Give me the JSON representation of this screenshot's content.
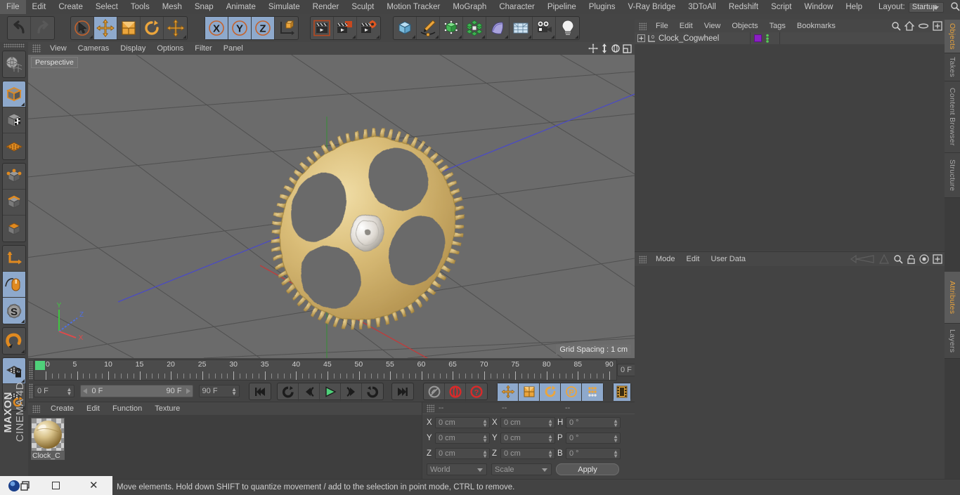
{
  "menubar": {
    "items": [
      "File",
      "Edit",
      "Create",
      "Select",
      "Tools",
      "Mesh",
      "Snap",
      "Animate",
      "Simulate",
      "Render",
      "Sculpt",
      "Motion Tracker",
      "MoGraph",
      "Character",
      "Pipeline",
      "Plugins",
      "V-Ray Bridge",
      "3DToAll",
      "Redshift",
      "Script",
      "Window",
      "Help"
    ],
    "layout_label": "Layout:",
    "layout_value": "Startup",
    "search_icon": "search-icon"
  },
  "toolbar": {
    "groups": [
      {
        "name": "undo-redo",
        "buttons": [
          {
            "id": "undo",
            "icon": "undo-arrow-icon",
            "active": false,
            "dim": false,
            "corner": false
          },
          {
            "id": "redo",
            "icon": "redo-arrow-icon",
            "active": false,
            "dim": true,
            "corner": false
          }
        ]
      },
      {
        "name": "transform-tools",
        "buttons": [
          {
            "id": "live-selection",
            "icon": "selection-cursor-icon",
            "active": false,
            "dim": false,
            "corner": true
          },
          {
            "id": "move",
            "icon": "move-arrows-icon",
            "active": true,
            "dim": false,
            "corner": false
          },
          {
            "id": "scale",
            "icon": "scale-box-icon",
            "active": false,
            "dim": false,
            "corner": false
          },
          {
            "id": "rotate",
            "icon": "rotate-circle-icon",
            "active": false,
            "dim": false,
            "corner": false
          },
          {
            "id": "axis-move",
            "icon": "move-arrows-icon",
            "active": false,
            "dim": false,
            "corner": true
          }
        ]
      },
      {
        "name": "axis-locks",
        "buttons": [
          {
            "id": "lock-x",
            "icon": "axis-x-icon",
            "active": true,
            "dim": false,
            "corner": false
          },
          {
            "id": "lock-y",
            "icon": "axis-y-icon",
            "active": true,
            "dim": false,
            "corner": false
          },
          {
            "id": "lock-z",
            "icon": "axis-z-icon",
            "active": true,
            "dim": false,
            "corner": false
          },
          {
            "id": "world-object-coords",
            "icon": "world-axis-cube-icon",
            "active": false,
            "dim": false,
            "corner": false
          }
        ]
      },
      {
        "name": "render-tools",
        "buttons": [
          {
            "id": "render-view",
            "icon": "clapper-view-icon",
            "active": false,
            "dim": false,
            "corner": false
          },
          {
            "id": "render-picture-viewer",
            "icon": "clapper-picture-icon",
            "active": false,
            "dim": false,
            "corner": true
          },
          {
            "id": "render-settings",
            "icon": "clapper-gear-icon",
            "active": false,
            "dim": false,
            "corner": true
          }
        ]
      },
      {
        "name": "create-objects",
        "buttons": [
          {
            "id": "add-cube",
            "icon": "blue-cube-icon",
            "active": false,
            "dim": false,
            "corner": true
          },
          {
            "id": "add-spline",
            "icon": "pen-spline-icon",
            "active": false,
            "dim": false,
            "corner": true
          },
          {
            "id": "add-generator",
            "icon": "green-cube-points-icon",
            "active": false,
            "dim": false,
            "corner": true
          },
          {
            "id": "add-deformer",
            "icon": "green-array-icon",
            "active": false,
            "dim": false,
            "corner": true
          },
          {
            "id": "add-scene-object",
            "icon": "purple-bend-icon",
            "active": false,
            "dim": false,
            "corner": true
          },
          {
            "id": "add-environment",
            "icon": "sky-grid-icon",
            "active": false,
            "dim": false,
            "corner": true
          },
          {
            "id": "add-camera",
            "icon": "camera-icon",
            "active": false,
            "dim": false,
            "corner": true
          },
          {
            "id": "add-light",
            "icon": "light-bulb-icon",
            "active": false,
            "dim": false,
            "corner": true
          }
        ]
      }
    ]
  },
  "left_toolbar": {
    "groups": [
      {
        "name": "mode-top",
        "buttons": [
          {
            "id": "make-editable",
            "icon": "globe-mesh-icon",
            "active": false,
            "corner": false
          }
        ]
      },
      {
        "name": "mode-model",
        "buttons": [
          {
            "id": "model-mode",
            "icon": "cube-orange-outline-icon",
            "active": true,
            "corner": true
          },
          {
            "id": "texture-mode",
            "icon": "checker-cube-icon",
            "active": false,
            "corner": false
          },
          {
            "id": "workplane-mode",
            "icon": "orange-grid-plane-icon",
            "active": false,
            "corner": false
          }
        ]
      },
      {
        "name": "component-modes",
        "buttons": [
          {
            "id": "points-mode",
            "icon": "cube-points-icon",
            "active": false,
            "corner": false
          },
          {
            "id": "edges-mode",
            "icon": "cube-edges-icon",
            "active": false,
            "corner": false
          },
          {
            "id": "polygons-mode",
            "icon": "cube-polygon-icon",
            "active": false,
            "corner": false
          }
        ]
      },
      {
        "name": "axis-tools",
        "buttons": [
          {
            "id": "enable-axis",
            "icon": "axis-orange-icon",
            "active": false,
            "corner": false
          },
          {
            "id": "viewport-solo",
            "icon": "mouse-icon",
            "active": true,
            "corner": false
          },
          {
            "id": "soft-selection",
            "icon": "s-circle-icon",
            "active": true,
            "corner": true
          }
        ]
      },
      {
        "name": "snap-tools",
        "buttons": [
          {
            "id": "snap-magnet",
            "icon": "magnet-icon",
            "active": false,
            "corner": true
          }
        ]
      },
      {
        "name": "workplane-tools",
        "buttons": [
          {
            "id": "lock-workplane",
            "icon": "grid-lock-icon",
            "active": true,
            "corner": true
          },
          {
            "id": "planar-workplane",
            "icon": "grid-rotate-icon",
            "active": false,
            "corner": true
          }
        ]
      }
    ],
    "brand_bold": "MAXON",
    "brand_thin": "CINEMA 4D"
  },
  "viewport": {
    "menu": [
      "View",
      "Cameras",
      "Display",
      "Options",
      "Filter",
      "Panel"
    ],
    "corner_icons": [
      "pan-icon",
      "dolly-icon",
      "orbit-icon",
      "maximize-icon"
    ],
    "view_label": "Perspective",
    "grid_spacing": "Grid Spacing : 1 cm",
    "axis_gizmo": {
      "y": "Y",
      "z": "Z",
      "x": "X"
    },
    "object_color": "#cfae6a",
    "background_color": "#6b6b6b"
  },
  "timeline": {
    "green_marker": true,
    "tick_labels": [
      "0",
      "5",
      "10",
      "15",
      "20",
      "25",
      "30",
      "35",
      "40",
      "45",
      "50",
      "55",
      "60",
      "65",
      "70",
      "75",
      "80",
      "85",
      "90"
    ],
    "current_frame_top": "0 F",
    "current_frame_left": "0 F",
    "range_start": "0 F",
    "range_end": "90 F",
    "preview_end": "90 F",
    "transport": [
      {
        "id": "goto-start",
        "icon": "skip-start-icon",
        "active": false
      },
      {
        "id": "play-reverse-loop",
        "icon": "rewind-loop-icon",
        "active": false
      },
      {
        "id": "step-back",
        "icon": "step-back-icon",
        "active": false
      },
      {
        "id": "play",
        "icon": "play-green-icon",
        "active": false
      },
      {
        "id": "step-forward",
        "icon": "step-forward-icon",
        "active": false
      },
      {
        "id": "play-forward-loop",
        "icon": "forward-loop-icon",
        "active": false
      }
    ],
    "transport2": [
      {
        "id": "goto-end",
        "icon": "skip-end-icon",
        "active": false
      }
    ],
    "keys": [
      {
        "id": "autokey",
        "icon": "key-gray-icon",
        "active": false
      },
      {
        "id": "record-active",
        "icon": "record-red-icon",
        "active": false
      },
      {
        "id": "keyframe-selection",
        "icon": "question-red-icon",
        "active": false
      }
    ],
    "pla": [
      {
        "id": "key-position",
        "icon": "move-arrows-icon",
        "active": true
      },
      {
        "id": "key-scale",
        "icon": "scale-box-icon",
        "active": true
      },
      {
        "id": "key-rotation",
        "icon": "rotate-circle-icon",
        "active": true
      },
      {
        "id": "key-pla",
        "icon": "p-circle-icon",
        "active": true
      },
      {
        "id": "key-param",
        "icon": "dots-grid-icon",
        "active": true
      }
    ],
    "timeline_btn": {
      "id": "timeline-toggle",
      "icon": "filmstrip-icon",
      "active": true
    }
  },
  "materials": {
    "menu": [
      "Create",
      "Edit",
      "Function",
      "Texture"
    ],
    "items": [
      {
        "name": "Clock_C",
        "preview": "gold-sphere"
      }
    ]
  },
  "coordinates": {
    "headers": [
      "--",
      "--",
      "--"
    ],
    "rows": [
      {
        "pos_label": "X",
        "pos_value": "0 cm",
        "size_label": "X",
        "size_value": "0 cm",
        "rot_label": "H",
        "rot_value": "0 °"
      },
      {
        "pos_label": "Y",
        "pos_value": "0 cm",
        "size_label": "Y",
        "size_value": "0 cm",
        "rot_label": "P",
        "rot_value": "0 °"
      },
      {
        "pos_label": "Z",
        "pos_value": "0 cm",
        "size_label": "Z",
        "size_value": "0 cm",
        "rot_label": "B",
        "rot_value": "0 °"
      }
    ],
    "coord_system": "World",
    "transform_mode": "Scale",
    "apply_label": "Apply"
  },
  "object_manager": {
    "menu": [
      "File",
      "Edit",
      "View",
      "Objects",
      "Tags",
      "Bookmarks"
    ],
    "icons": [
      "search-icon",
      "home-icon",
      "ellipse-icon",
      "plus-box-icon"
    ],
    "rows": [
      {
        "name": "Clock_Cogwheel",
        "tag_color": "#8b1fc4",
        "expandable": true,
        "selected": true
      }
    ]
  },
  "attribute_manager": {
    "menu": [
      "Mode",
      "Edit",
      "User Data"
    ],
    "icons": [
      "back-nav-icon",
      "up-nav-icon",
      "search-icon",
      "lock-icon",
      "target-icon",
      "plus-box-icon"
    ]
  },
  "right_tabs": [
    {
      "label": "Objects",
      "active": true
    },
    {
      "label": "Takes",
      "active": false
    },
    {
      "label": "Content Browser",
      "active": false
    },
    {
      "label": "Structure",
      "active": false
    },
    {
      "label": "Attributes",
      "active": true
    },
    {
      "label": "Layers",
      "active": false
    }
  ],
  "status_bar": {
    "text": "Move elements. Hold down SHIFT to quantize movement / add to the selection in point mode, CTRL to remove."
  },
  "window_controls": {
    "minimize": "minimize-icon",
    "maximize": "maximize-square-icon",
    "close": "close-x-icon"
  }
}
